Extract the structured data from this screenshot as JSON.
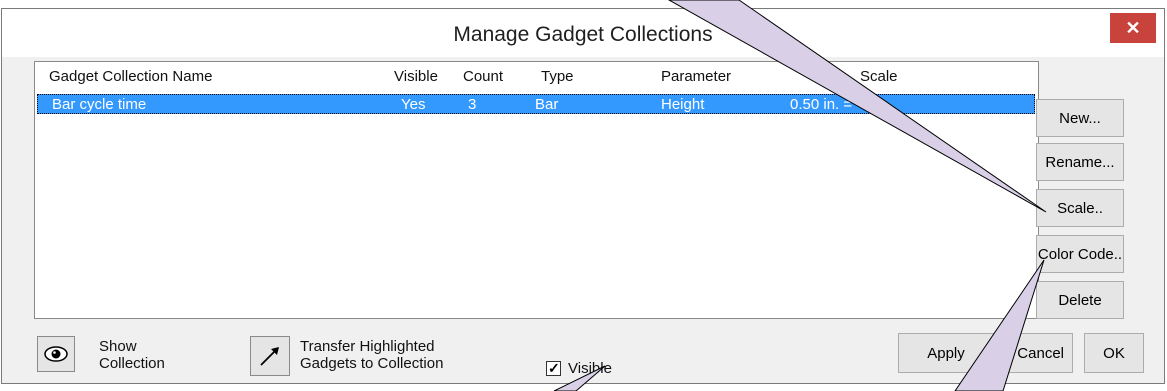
{
  "dialog": {
    "title": "Manage Gadget Collections",
    "close_symbol": "✕"
  },
  "list": {
    "columns": [
      "Gadget Collection Name",
      "Visible",
      "Count",
      "Type",
      "Parameter",
      "Scale"
    ],
    "rows": [
      {
        "name": "Bar  cycle time",
        "visible": "Yes",
        "count": "3",
        "type": "Bar",
        "parameter": "Height",
        "scale": "0.50 in. = "
      }
    ]
  },
  "side_buttons": {
    "new": "New...",
    "rename": "Rename...",
    "scale": "Scale..",
    "color_code": "Color Code..",
    "delete": "Delete"
  },
  "bottom": {
    "show_label_1": "Show",
    "show_label_2": "Collection",
    "transfer_label_1": "Transfer Highlighted",
    "transfer_label_2": "Gadgets to Collection",
    "visible_check_label": "Visible",
    "visible_check_mark": "✓",
    "apply": "Apply",
    "cancel": "Cancel",
    "ok": "OK"
  },
  "icons": {
    "show": "eye-icon",
    "transfer": "arrow-icon"
  },
  "colors": {
    "selection": "#3399ff",
    "close": "#c7433b",
    "callout_fill": "#d9d0e8"
  }
}
